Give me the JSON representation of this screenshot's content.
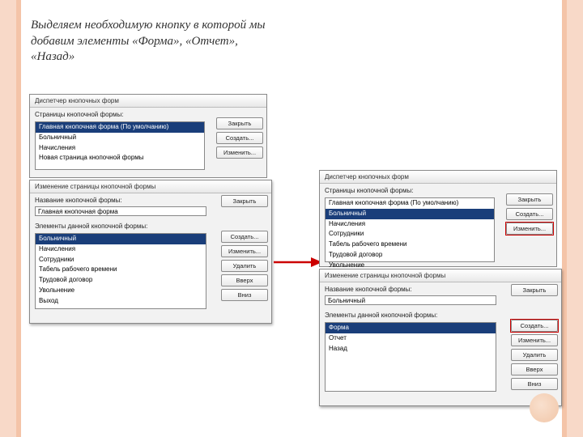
{
  "heading": "Выделяем необходимую кнопку в которой мы добавим элементы «Форма», «Отчет», «Назад»",
  "left_top": {
    "title": "Диспетчер кнопочных форм",
    "section": "Страницы кнопочной формы:",
    "items": {
      "selected": "Главная кнопочная форма (По умолчанию)",
      "a": "Больничный",
      "b": "Начисления",
      "c": "Новая страница кнопочной формы"
    },
    "btns": {
      "close": "Закрыть",
      "create": "Создать...",
      "edit": "Изменить..."
    }
  },
  "left_mid": {
    "title": "Изменение страницы кнопочной формы",
    "name_label": "Название кнопочной формы:",
    "name_value": "Главная кнопочная форма",
    "elements_label": "Элементы данной кнопочной формы:",
    "items": {
      "selected": "Больничный",
      "a": "Начисления",
      "b": "Сотрудники",
      "c": "Табель рабочего времени",
      "d": "Трудовой договор",
      "e": "Увольнение",
      "f": "Выход"
    },
    "btns": {
      "close": "Закрыть",
      "create": "Создать...",
      "edit": "Изменить...",
      "delete": "Удалить",
      "up": "Вверх",
      "down": "Вниз"
    }
  },
  "right_top": {
    "title": "Диспетчер кнопочных форм",
    "section": "Страницы кнопочной формы:",
    "items": {
      "a": "Главная кнопочная форма (По умолчанию)",
      "selected": "Больничный",
      "b": "Начисления",
      "c": "Сотрудники",
      "d": "Табель рабочего времени",
      "e": "Трудовой договор",
      "f": "Увольнение"
    },
    "btns": {
      "close": "Закрыть",
      "create": "Создать...",
      "edit": "Изменить..."
    }
  },
  "right_mid": {
    "title": "Изменение страницы кнопочной формы",
    "name_label": "Название кнопочной формы:",
    "name_value": "Больничный",
    "elements_label": "Элементы данной кнопочной формы:",
    "items": {
      "selected": "Форма",
      "a": "Отчет",
      "b": "Назад"
    },
    "btns": {
      "close": "Закрыть",
      "create": "Создать...",
      "edit": "Изменить...",
      "delete": "Удалить",
      "up": "Вверх",
      "down": "Вниз"
    }
  }
}
